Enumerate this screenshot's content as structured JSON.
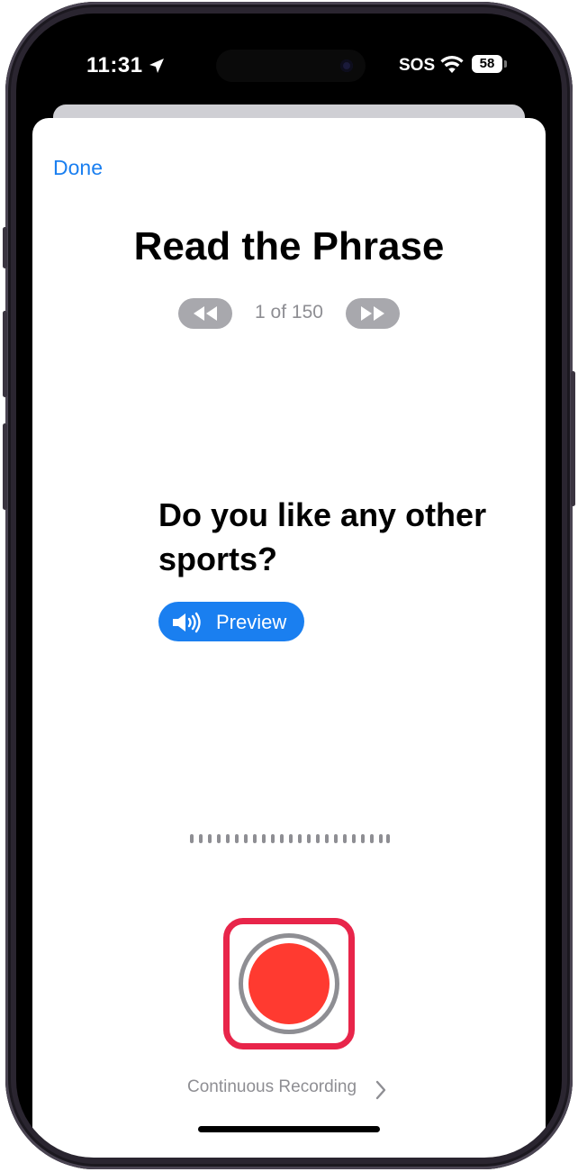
{
  "status_bar": {
    "time": "11:31",
    "sos": "SOS",
    "battery": "58"
  },
  "sheet": {
    "done_label": "Done",
    "title": "Read the Phrase",
    "counter": "1 of 150",
    "phrase": "Do you like any other sports?",
    "preview_label": "Preview",
    "continuous_label": "Continuous Recording"
  },
  "colors": {
    "accent": "#1a7ff0",
    "record": "#ff3a30",
    "highlight": "#e8254a",
    "secondary_text": "#8e8e93"
  },
  "icons": [
    "location-arrow-icon",
    "wifi-icon",
    "rewind-icon",
    "fast-forward-icon",
    "speaker-icon",
    "chevron-right-icon"
  ]
}
